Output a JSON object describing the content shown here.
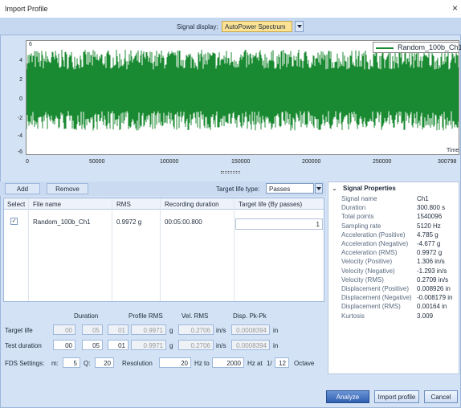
{
  "window": {
    "title": "Import Profile",
    "close_glyph": "×"
  },
  "signal_display": {
    "label": "Signal display:",
    "value": "AutoPower Spectrum"
  },
  "chart_data": {
    "type": "line",
    "series": [
      {
        "name": "Random_100b_Ch1",
        "color": "#1a8a32",
        "amplitude_rms": 0.9972,
        "peak_positive": 4.785,
        "peak_negative": -4.677
      }
    ],
    "xlim": [
      0,
      300798
    ],
    "ylim": [
      -6,
      4.5
    ],
    "xticks": [
      "0",
      "50000",
      "100000",
      "150000",
      "200000",
      "250000",
      "300798"
    ],
    "yticks": [
      "4",
      "2",
      "0",
      "-2",
      "-4",
      "-6"
    ],
    "xlabel": "Time",
    "top_left_label": "6",
    "grid": false,
    "legend": "top-right"
  },
  "toolbar": {
    "add_label": "Add",
    "remove_label": "Remove",
    "target_life_type_label": "Target life type:",
    "target_life_type_value": "Passes"
  },
  "table": {
    "headers": [
      "Select",
      "File name",
      "RMS",
      "Recording duration",
      "Target life (By passes)"
    ],
    "rows": [
      {
        "checked": "✓",
        "file": "Random_100b_Ch1",
        "rms": "0.9972 g",
        "duration": "00:05:00.800",
        "life": "1"
      }
    ]
  },
  "signal_properties": {
    "title": "Signal Properties",
    "rows": [
      {
        "k": "Signal name",
        "v": "Ch1"
      },
      {
        "k": "Duration",
        "v": "300.800 s"
      },
      {
        "k": "Total points",
        "v": "1540096"
      },
      {
        "k": "Sampling rate",
        "v": "5120 Hz"
      },
      {
        "k": "Acceleration (Positive)",
        "v": "4.785 g"
      },
      {
        "k": "Acceleration (Negative)",
        "v": "-4.677 g"
      },
      {
        "k": "Acceleration (RMS)",
        "v": "0.9972 g"
      },
      {
        "k": "Velocity (Positive)",
        "v": "1.306 in/s"
      },
      {
        "k": "Velocity (Negative)",
        "v": "-1.293 in/s"
      },
      {
        "k": "Velocity (RMS)",
        "v": "0.2709 in/s"
      },
      {
        "k": "Displacement (Positive)",
        "v": "0.008926 in"
      },
      {
        "k": "Displacement (Negative)",
        "v": "-0.008179 in"
      },
      {
        "k": "Displacement (RMS)",
        "v": "0.00164 in"
      },
      {
        "k": "Kurtosis",
        "v": "3.009"
      }
    ]
  },
  "durations": {
    "headers": {
      "duration": "Duration",
      "profile_rms": "Profile RMS",
      "vel_rms": "Vel. RMS",
      "disp": "Disp. Pk-Pk"
    },
    "target_life": {
      "label": "Target life",
      "h": "00",
      "m": "05",
      "s": "01",
      "rms": "0.9971",
      "rms_unit": "g",
      "vel": "0.2706",
      "vel_unit": "in/s",
      "disp": "0.0008394",
      "disp_unit": "in"
    },
    "test_duration": {
      "label": "Test duration",
      "h": "00",
      "m": "05",
      "s": "01",
      "rms": "0.9971",
      "rms_unit": "g",
      "vel": "0.2706",
      "vel_unit": "in/s",
      "disp": "0.0008394",
      "disp_unit": "in"
    }
  },
  "fds": {
    "label": "FDS Settings:",
    "m_label": "m:",
    "m": "5",
    "q_label": "Q:",
    "q": "20",
    "res_label": "Resolution",
    "hz_from": "20",
    "hz_to_label": "Hz to",
    "hz_to": "2000",
    "hz_at_label": "Hz at",
    "oct_prefix": "1/",
    "oct": "12",
    "oct_label": "Octave"
  },
  "buttons": {
    "analyze": "Analyze",
    "import": "Import profile",
    "cancel": "Cancel"
  }
}
